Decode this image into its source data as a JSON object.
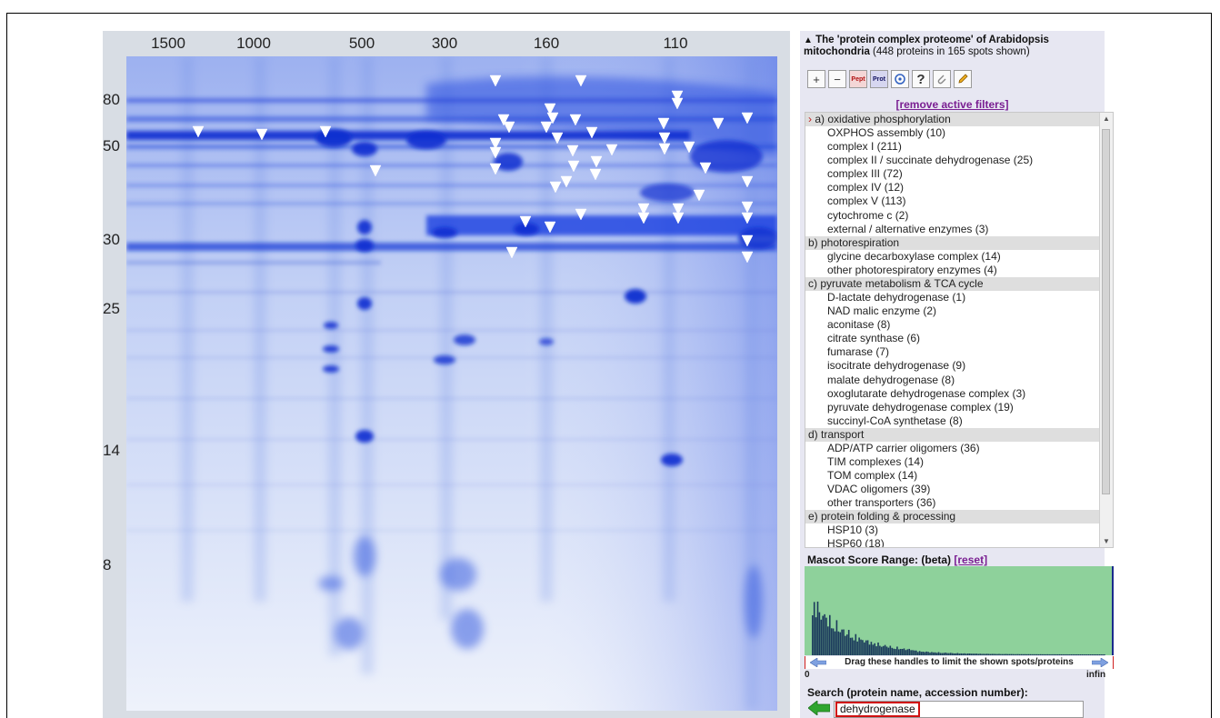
{
  "gel": {
    "x_labels": [
      "1500",
      "1000",
      "500",
      "300",
      "160",
      "110"
    ],
    "y_labels": [
      "80",
      "50",
      "30",
      "25",
      "14",
      "8"
    ]
  },
  "panel": {
    "title_bold": "The 'protein complex proteome' of Arabidopsis mitochondria",
    "title_note": "(448 proteins in 165 spots shown)",
    "toolbar": {
      "zoom_in": "+",
      "zoom_out": "−",
      "pept": "Pept",
      "prot": "Prot",
      "help": "?"
    },
    "remove_filters": "[remove active filters]",
    "filters": [
      {
        "label": "a) oxidative phosphorylation",
        "active": true,
        "items": [
          "OXPHOS assembly (10)",
          "complex I (211)",
          "complex II / succinate dehydrogenase (25)",
          "complex III (72)",
          "complex IV (12)",
          "complex V (113)",
          "cytochrome c (2)",
          "external / alternative enzymes (3)"
        ]
      },
      {
        "label": "b) photorespiration",
        "active": false,
        "items": [
          "glycine decarboxylase complex (14)",
          "other photorespiratory enzymes (4)"
        ]
      },
      {
        "label": "c) pyruvate metabolism & TCA cycle",
        "active": false,
        "items": [
          "D-lactate dehydrogenase (1)",
          "NAD malic enzyme (2)",
          "aconitase (8)",
          "citrate synthase (6)",
          "fumarase (7)",
          "isocitrate dehydrogenase (9)",
          "malate dehydrogenase (8)",
          "oxoglutarate dehydrogenase complex (3)",
          "pyruvate dehydrogenase complex (19)",
          "succinyl-CoA synthetase (8)"
        ]
      },
      {
        "label": "d) transport",
        "active": false,
        "items": [
          "ADP/ATP carrier oligomers (36)",
          "TIM complexes (14)",
          "TOM complex (14)",
          "VDAC oligomers (39)",
          "other transporters (36)"
        ]
      },
      {
        "label": "e) protein folding & processing",
        "active": false,
        "items": [
          "HSP10 (3)",
          "HSP60 (18)"
        ]
      }
    ],
    "mascot": {
      "title": "Mascot Score Range: (beta)",
      "reset": "[reset]",
      "handles_text": "Drag these handles to limit the shown spots/proteins",
      "min_label": "0",
      "max_label": "infin"
    },
    "search": {
      "label": "Search (protein name, accession number):",
      "value": "dehydrogenase"
    }
  },
  "colors": {
    "gel_blue": "#1438d8",
    "histogram_bg": "#8ed19b",
    "histogram_bar": "#1b3a5c",
    "link_purple": "#7a1f92",
    "highlight_red": "#d01010"
  }
}
